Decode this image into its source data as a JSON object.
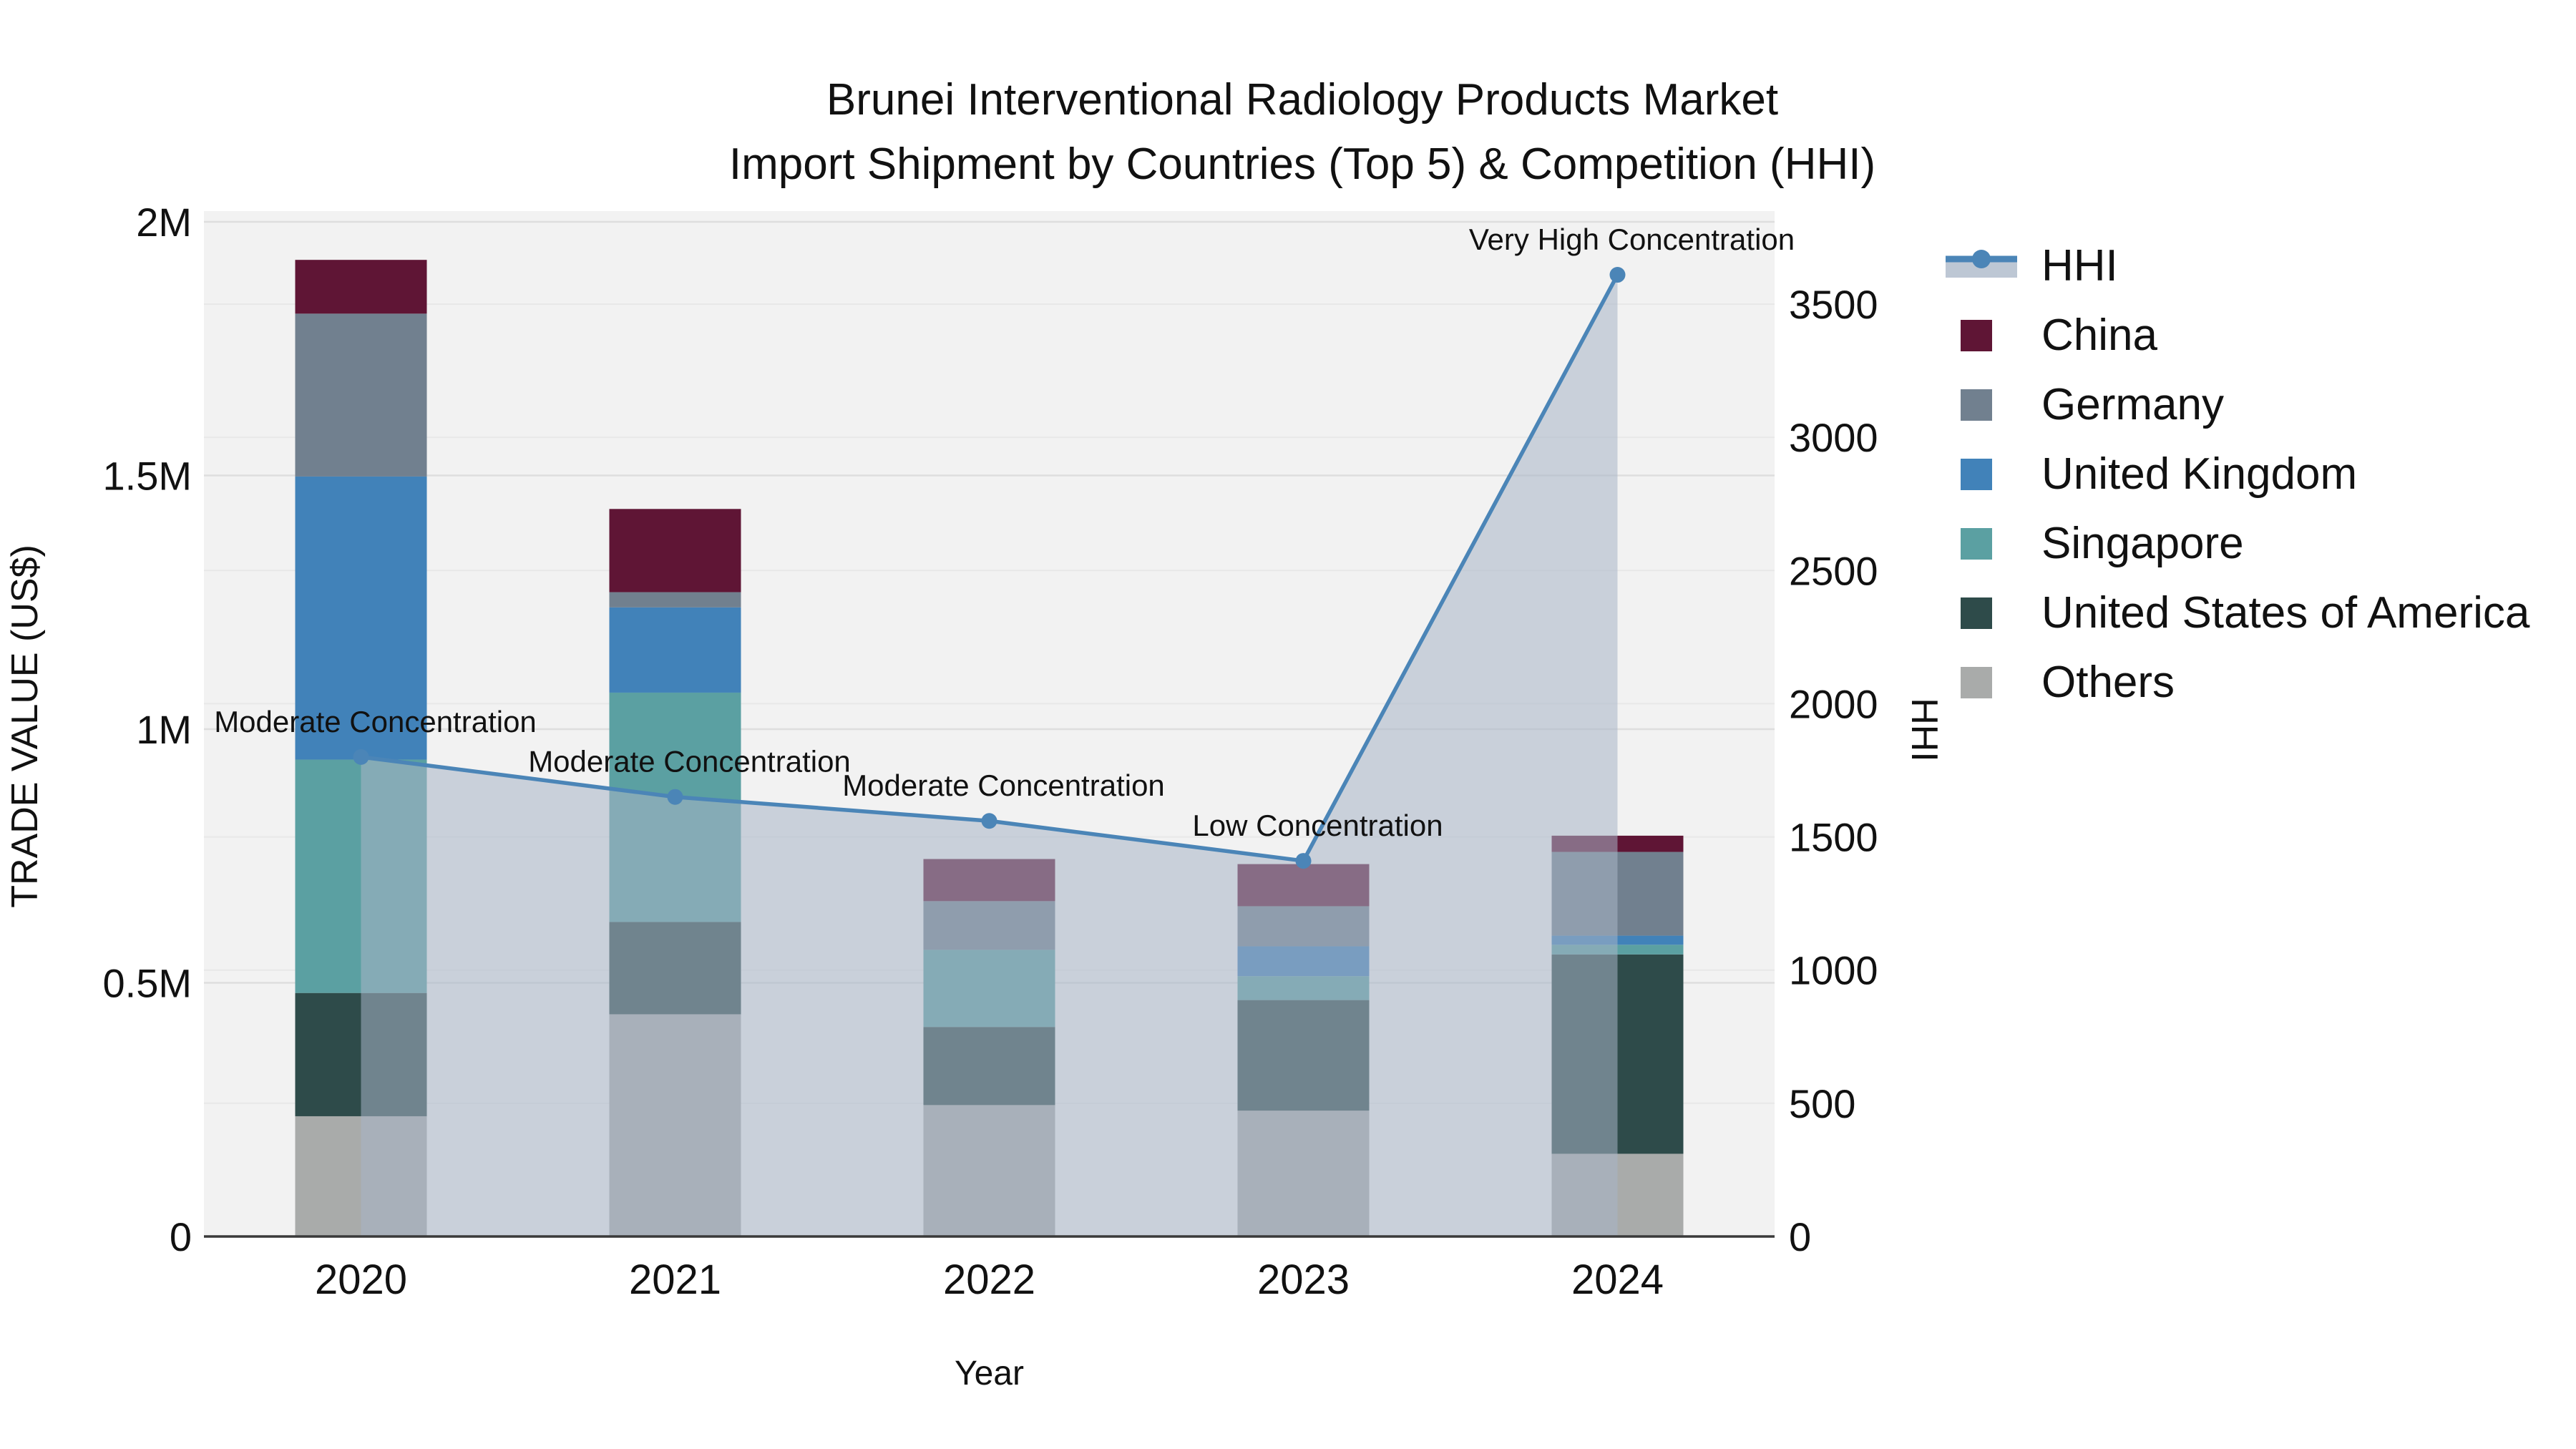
{
  "title": {
    "line1": "Brunei Interventional Radiology Products Market",
    "line2": "Import Shipment by Countries (Top 5) & Competition (HHI)"
  },
  "axes": {
    "x": {
      "label": "Year",
      "tick_labels": [
        "2020",
        "2021",
        "2022",
        "2023",
        "2024"
      ]
    },
    "y_left": {
      "label": "TRADE VALUE (US$)",
      "tick_labels": [
        "0",
        "0.5M",
        "1M",
        "1.5M",
        "2M"
      ],
      "tick_values": [
        0,
        500000,
        1000000,
        1500000,
        2000000
      ],
      "max": 2000000
    },
    "y_right": {
      "label": "HHI",
      "tick_labels": [
        "0",
        "500",
        "1000",
        "1500",
        "2000",
        "2500",
        "3000",
        "3500"
      ],
      "tick_values": [
        0,
        500,
        1000,
        1500,
        2000,
        2500,
        3000,
        3500
      ],
      "max": 3500
    }
  },
  "legend": {
    "items": [
      {
        "label": "HHI",
        "type": "line",
        "color": "#4b85b7"
      },
      {
        "label": "China",
        "type": "square",
        "color": "#5f1535"
      },
      {
        "label": "Germany",
        "type": "square",
        "color": "#71808f"
      },
      {
        "label": "United Kingdom",
        "type": "square",
        "color": "#4182b9"
      },
      {
        "label": "Singapore",
        "type": "square",
        "color": "#5ba0a2"
      },
      {
        "label": "United States of America",
        "type": "square",
        "color": "#2e4b4a"
      },
      {
        "label": "Others",
        "type": "square",
        "color": "#a9abaa"
      }
    ]
  },
  "chart_data": {
    "type": "bar",
    "subtype": "stacked_bars_with_secondary_line",
    "title": "Brunei Interventional Radiology Products Market — Import Shipment by Countries (Top 5) & Competition (HHI)",
    "xlabel": "Year",
    "ylabel_left": "TRADE VALUE (US$)",
    "ylabel_right": "HHI",
    "categories": [
      "2020",
      "2021",
      "2022",
      "2023",
      "2024"
    ],
    "stack_order_bottom_to_top": [
      "Others",
      "United States of America",
      "Singapore",
      "United Kingdom",
      "Germany",
      "China"
    ],
    "series": [
      {
        "name": "China",
        "color": "#5f1535",
        "values": [
          106000,
          164000,
          83000,
          83000,
          32000
        ]
      },
      {
        "name": "Germany",
        "color": "#71808f",
        "values": [
          321000,
          30000,
          96000,
          79000,
          165000
        ]
      },
      {
        "name": "United Kingdom",
        "color": "#4182b9",
        "values": [
          558000,
          168000,
          0,
          59000,
          18000
        ]
      },
      {
        "name": "Singapore",
        "color": "#5ba0a2",
        "values": [
          460000,
          452000,
          152000,
          47000,
          19000
        ]
      },
      {
        "name": "United States of America",
        "color": "#2e4b4a",
        "values": [
          243000,
          182000,
          154000,
          218000,
          393000
        ]
      },
      {
        "name": "Others",
        "color": "#a9abaa",
        "values": [
          237000,
          438000,
          259000,
          248000,
          163000
        ]
      }
    ],
    "bar_totals": [
      1925000,
      1434000,
      744000,
      734000,
      790000
    ],
    "line_series": {
      "name": "HHI",
      "axis": "right",
      "color": "#4b85b7",
      "values": [
        1800,
        1650,
        1560,
        1410,
        3610
      ],
      "area_fill_under_line": true,
      "area_color": "rgba(167,180,198,0.55)",
      "marker": "circle"
    },
    "point_annotations": [
      "Moderate Concentration",
      "Moderate Concentration",
      "Moderate Concentration",
      "Low Concentration",
      "Very High Concentration"
    ],
    "ylim_left": [
      0,
      2000000
    ],
    "ylim_right": [
      0,
      3500
    ],
    "grid": true,
    "legend_position": "outside-right",
    "plot_background": "#f2f2f2"
  },
  "style": {
    "page_bg": "#ffffff",
    "plot_bg": "#f2f2f2",
    "grid_left_color": "#dedede",
    "grid_right_color": "#e8e8e8",
    "axis_line_color": "#3a3a3a",
    "text_color": "#111111"
  }
}
